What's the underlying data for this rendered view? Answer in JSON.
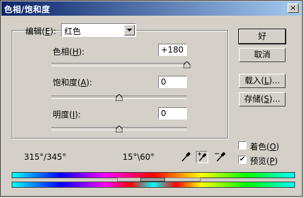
{
  "title": "色相/饱和度",
  "close_glyph": "×",
  "edit": {
    "label_pre": "编辑(",
    "label_key": "E",
    "label_post": "):",
    "value": "红色"
  },
  "hue": {
    "label_pre": "色相(",
    "label_key": "H",
    "label_post": "):",
    "value": "+180",
    "level": 1.0
  },
  "saturation": {
    "label_pre": "饱和度(",
    "label_key": "A",
    "label_post": "):",
    "value": "0",
    "level": 0.5
  },
  "lightness": {
    "label_pre": "明度(",
    "label_key": "I",
    "label_post": "):",
    "value": "0",
    "level": 0.5
  },
  "buttons": {
    "ok": "好",
    "cancel": "取消",
    "load": {
      "pre": "载入(",
      "key": "L",
      "post": ")..."
    },
    "save": {
      "pre": "存储(",
      "key": "S",
      "post": ")..."
    }
  },
  "colorize": {
    "pre": "着色(",
    "key": "O",
    "post": ")",
    "checked": false
  },
  "preview": {
    "pre": "预览(",
    "key": "P",
    "post": ")",
    "checked": true,
    "check_glyph": "✔"
  },
  "range_left": "315°/345°",
  "range_right": "15°\\60°",
  "icons": [
    "eyedropper-icon",
    "eyedropper-plus-icon",
    "eyedropper-minus-icon"
  ]
}
